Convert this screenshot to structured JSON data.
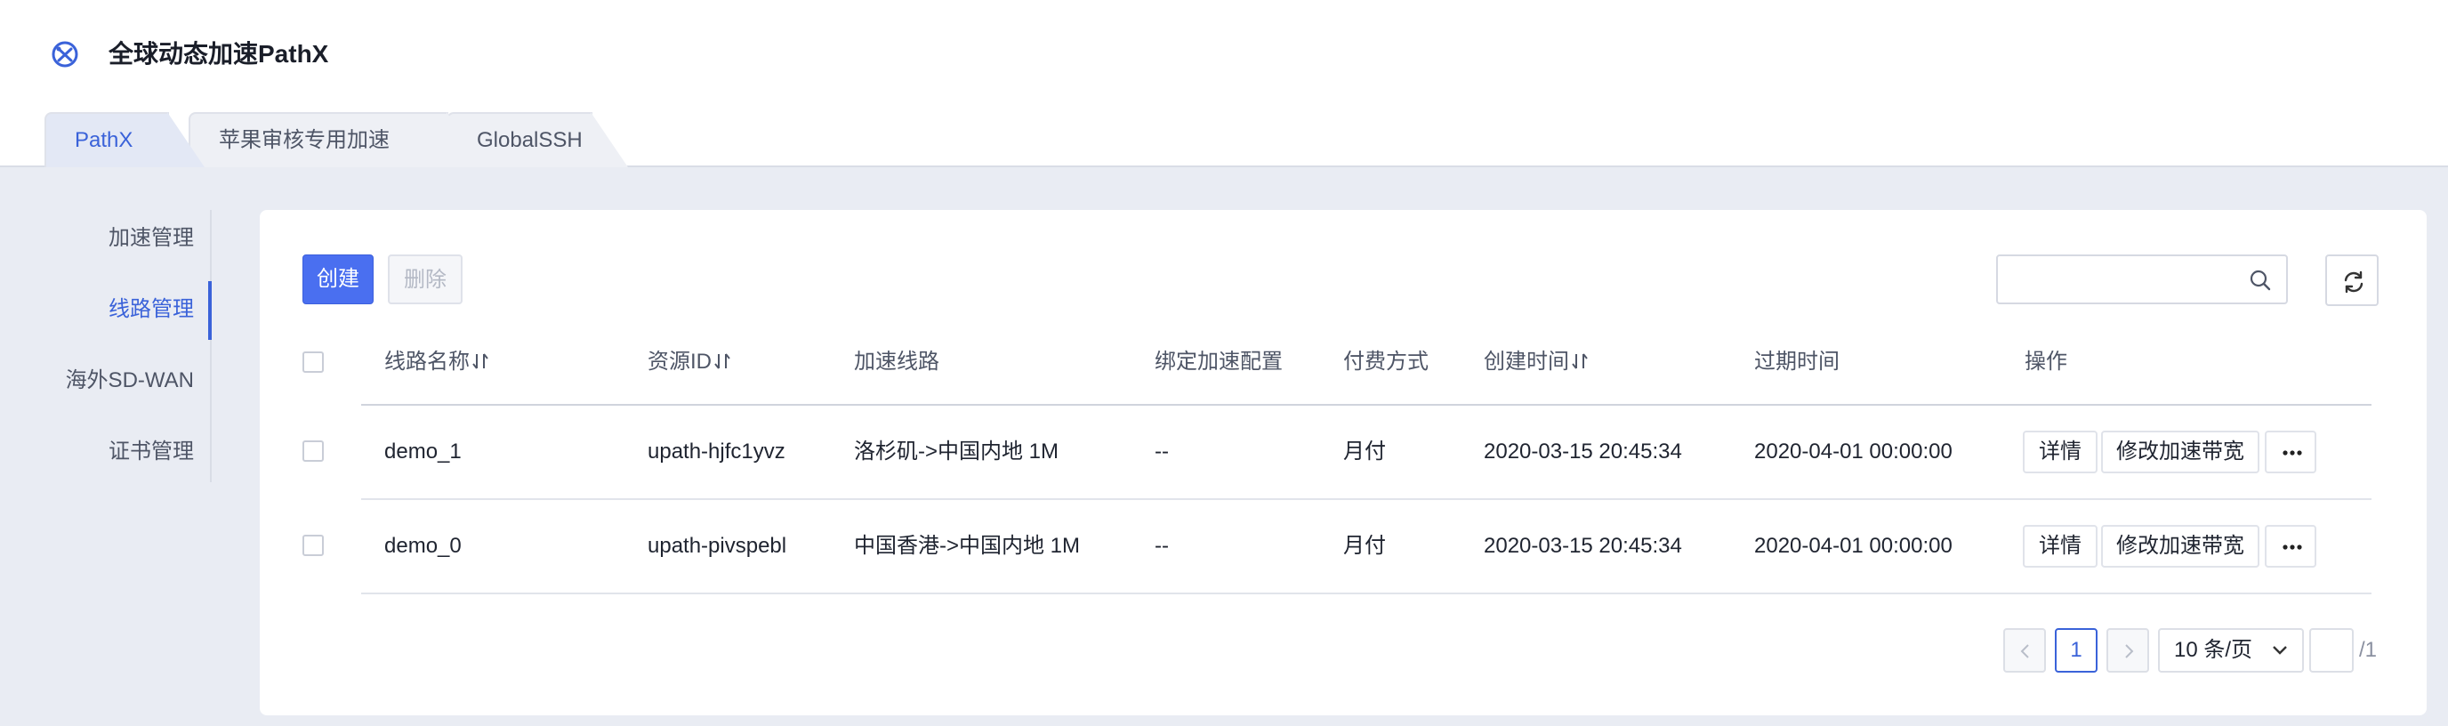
{
  "app": {
    "title": "全球动态加速PathX",
    "icon": "pathx-logo-icon"
  },
  "tabs": [
    {
      "label": "PathX",
      "active": true
    },
    {
      "label": "苹果审核专用加速",
      "active": false
    },
    {
      "label": "GlobalSSH",
      "active": false
    }
  ],
  "sidebar": {
    "items": [
      {
        "label": "加速管理",
        "active": false
      },
      {
        "label": "线路管理",
        "active": true
      },
      {
        "label": "海外SD-WAN",
        "active": false
      },
      {
        "label": "证书管理",
        "active": false
      }
    ]
  },
  "toolbar": {
    "create_label": "创建",
    "delete_label": "删除",
    "search_placeholder": "",
    "search_icon": "search-icon",
    "refresh_icon": "refresh-icon"
  },
  "table": {
    "columns": [
      "线路名称",
      "资源ID",
      "加速线路",
      "绑定加速配置",
      "付费方式",
      "创建时间",
      "过期时间",
      "操作"
    ],
    "rows": [
      {
        "name": "demo_1",
        "resource_id": "upath-hjfc1yvz",
        "line": "洛杉矶->中国内地 1M",
        "binding": "--",
        "pay": "月付",
        "created": "2020-03-15 20:45:34",
        "expires": "2020-04-01 00:00:00",
        "action_detail": "详情",
        "action_modify": "修改加速带宽"
      },
      {
        "name": "demo_0",
        "resource_id": "upath-pivspebl",
        "line": "中国香港->中国内地 1M",
        "binding": "--",
        "pay": "月付",
        "created": "2020-03-15 20:45:34",
        "expires": "2020-04-01 00:00:00",
        "action_detail": "详情",
        "action_modify": "修改加速带宽"
      }
    ]
  },
  "pagination": {
    "current_page": "1",
    "page_size_label": "10 条/页",
    "jump_value": "",
    "total_pages_label": "/1"
  },
  "colors": {
    "accent": "#3a62d9",
    "primary_button": "#4a6ff0",
    "background": "#e9ecf3"
  }
}
